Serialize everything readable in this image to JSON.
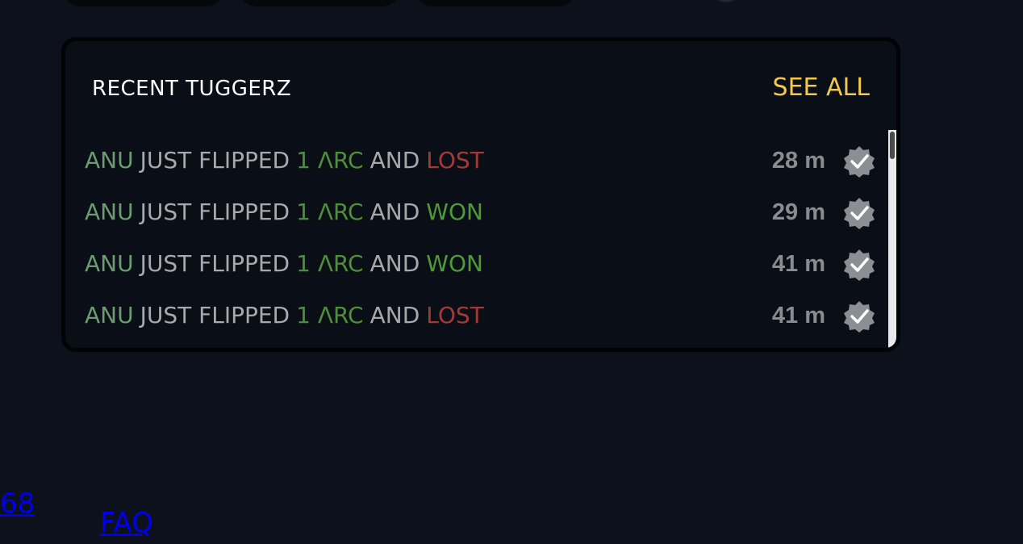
{
  "panel": {
    "title": "RECENT TUGGERZ",
    "see_all": "SEE ALL"
  },
  "feed": [
    {
      "user": "ANU",
      "verb": "JUST FLIPPED",
      "amount": "1 ΛRC",
      "conj": "AND",
      "result": "LOST",
      "time": "28 m"
    },
    {
      "user": "ANU",
      "verb": "JUST FLIPPED",
      "amount": "1 ΛRC",
      "conj": "AND",
      "result": "WON",
      "time": "29 m"
    },
    {
      "user": "ANU",
      "verb": "JUST FLIPPED",
      "amount": "1 ΛRC",
      "conj": "AND",
      "result": "WON",
      "time": "41 m"
    },
    {
      "user": "ANU",
      "verb": "JUST FLIPPED",
      "amount": "1 ΛRC",
      "conj": "AND",
      "result": "LOST",
      "time": "41 m"
    }
  ],
  "icons": {
    "badge": "verified-badge-icon"
  },
  "colors": {
    "background": "#0d111c",
    "panel": "#0a0e16",
    "accent": "#f2c94c",
    "user": "#6e9a73",
    "won": "#4e9a38",
    "lost": "#a43a36"
  },
  "footer": {
    "partial_number": "68",
    "faq": "FAQ"
  }
}
